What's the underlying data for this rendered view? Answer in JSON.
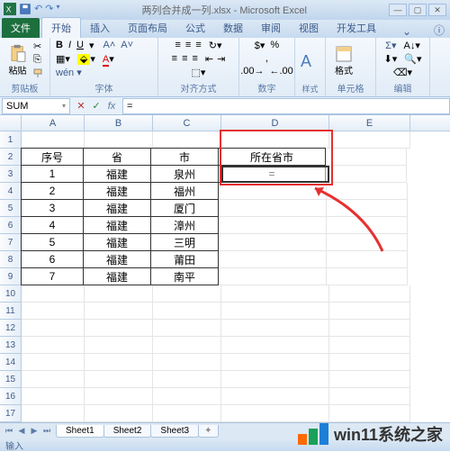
{
  "title": "两列合并成一列.xlsx - Microsoft Excel",
  "tabs": {
    "file": "文件",
    "home": "开始",
    "insert": "插入",
    "pagelayout": "页面布局",
    "formulas": "公式",
    "data": "数据",
    "review": "审阅",
    "view": "视图",
    "developer": "开发工具"
  },
  "ribbon_groups": {
    "clipboard": "剪贴板",
    "font": "字体",
    "alignment": "对齐方式",
    "number": "数字",
    "cells": "单元格",
    "editing": "编辑"
  },
  "paste_label": "粘贴",
  "format_label": "格式",
  "name_box": "SUM",
  "formula_value": "=",
  "columns": [
    "A",
    "B",
    "C",
    "D",
    "E"
  ],
  "rows_count": 17,
  "table": {
    "headers": {
      "seq": "序号",
      "province": "省",
      "city": "市",
      "combined": "所在省市"
    },
    "data": [
      {
        "seq": "1",
        "province": "福建",
        "city": "泉州"
      },
      {
        "seq": "2",
        "province": "福建",
        "city": "福州"
      },
      {
        "seq": "3",
        "province": "福建",
        "city": "厦门"
      },
      {
        "seq": "4",
        "province": "福建",
        "city": "漳州"
      },
      {
        "seq": "5",
        "province": "福建",
        "city": "三明"
      },
      {
        "seq": "6",
        "province": "福建",
        "city": "莆田"
      },
      {
        "seq": "7",
        "province": "福建",
        "city": "南平"
      }
    ]
  },
  "active_cell_value": "=",
  "sheets": [
    "Sheet1",
    "Sheet2",
    "Sheet3"
  ],
  "status": "输入",
  "watermark": "win11系统之家"
}
